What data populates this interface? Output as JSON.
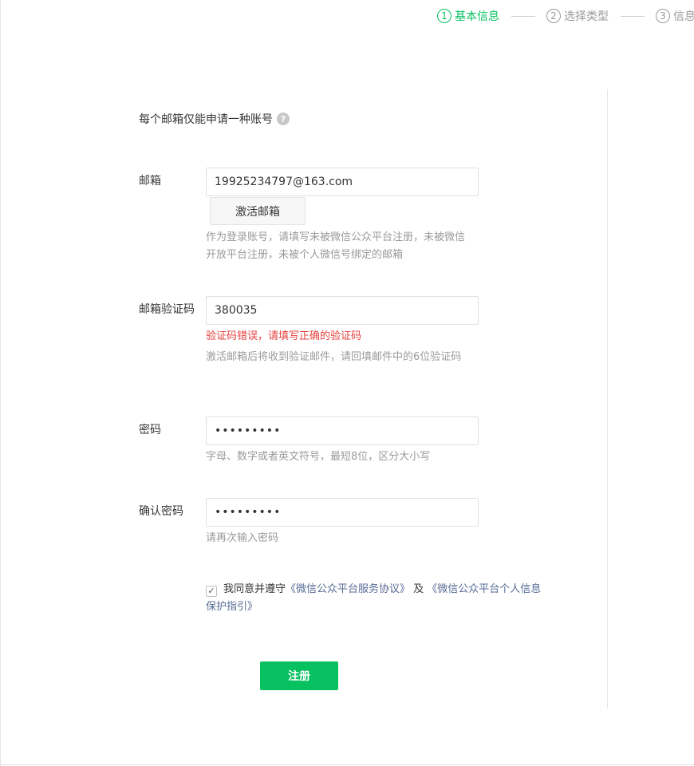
{
  "steps": [
    {
      "num": "1",
      "label": "基本信息",
      "active": true
    },
    {
      "num": "2",
      "label": "选择类型",
      "active": false
    },
    {
      "num": "3",
      "label": "信息",
      "active": false
    }
  ],
  "notice": {
    "text": "每个邮箱仅能申请一种账号",
    "icon": "question-circle-icon"
  },
  "email": {
    "label": "邮箱",
    "value": "19925234797@163.com",
    "activate_button": "激活邮箱",
    "hint": "作为登录账号，请填写未被微信公众平台注册，未被微信开放平台注册，未被个人微信号绑定的邮箱"
  },
  "code": {
    "label": "邮箱验证码",
    "value": "380035",
    "error": "验证码错误，请填写正确的验证码",
    "hint": "激活邮箱后将收到验证邮件，请回填邮件中的6位验证码"
  },
  "password": {
    "label": "密码",
    "value": "•••••••••",
    "hint": "字母、数字或者英文符号，最短8位，区分大小写"
  },
  "confirm": {
    "label": "确认密码",
    "value": "•••••••••",
    "hint": "请再次输入密码"
  },
  "agreement": {
    "prefix": "我同意并遵守",
    "link1": "《微信公众平台服务协议》",
    "and": " 及 ",
    "link2": "《微信公众平台个人信息保护指引》",
    "checked": true
  },
  "register_button": "注册",
  "colors": {
    "accent": "#07c160",
    "error": "#e64340",
    "link": "#576b95"
  }
}
